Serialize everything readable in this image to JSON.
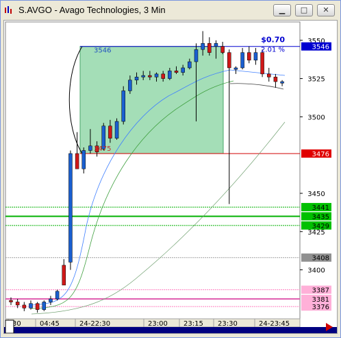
{
  "window": {
    "title": "S.AVGO - Avago Technologies, 3 Min",
    "buttons": [
      {
        "name": "minimize-button",
        "glyph": "▁"
      },
      {
        "name": "maximize-button",
        "glyph": "□"
      },
      {
        "name": "close-button",
        "glyph": "✕"
      }
    ]
  },
  "chart_data": {
    "type": "candlestick",
    "symbol": "S.AVGO",
    "interval": "3 Min",
    "ylim": [
      3368,
      3562
    ],
    "y_ticks": [
      3400,
      3425,
      3450,
      3500,
      3525,
      3550
    ],
    "x_labels": [
      "30",
      "04:45",
      "24-22:30",
      "23:00",
      "23:15",
      "23:30",
      "24-23:45"
    ],
    "price_tags": [
      {
        "value": "3546",
        "price": 3546,
        "bg": "#0000d0",
        "fg": "#ffffff"
      },
      {
        "value": "3476",
        "price": 3476,
        "bg": "#e00000",
        "fg": "#ffffff"
      },
      {
        "value": "3441",
        "price": 3441,
        "bg": "#00c000",
        "fg": "#000000"
      },
      {
        "value": "3435",
        "price": 3435,
        "bg": "#00c000",
        "fg": "#000000"
      },
      {
        "value": "3429",
        "price": 3429,
        "bg": "#00c000",
        "fg": "#000000"
      },
      {
        "value": "3408",
        "price": 3408,
        "bg": "#909090",
        "fg": "#000000"
      },
      {
        "value": "3387",
        "price": 3387,
        "bg": "#ffb0d8",
        "fg": "#000000"
      },
      {
        "value": "3381",
        "price": 3381,
        "bg": "#ffb0d8",
        "fg": "#000000"
      },
      {
        "value": "3376",
        "price": 3376,
        "bg": "#ffb0d8",
        "fg": "#000000"
      }
    ],
    "range_box": {
      "high": 3546,
      "low": 3476,
      "high_label": "3546",
      "low_label": "3475",
      "change_label": "$0.70",
      "change_pct_label": "2.01 %"
    },
    "candles": [
      {
        "o": 3380,
        "h": 3382,
        "l": 3377,
        "c": 3379,
        "up": false
      },
      {
        "o": 3379,
        "h": 3381,
        "l": 3375,
        "c": 3377,
        "up": false
      },
      {
        "o": 3377,
        "h": 3379,
        "l": 3373,
        "c": 3375,
        "up": false
      },
      {
        "o": 3375,
        "h": 3380,
        "l": 3374,
        "c": 3378,
        "up": true
      },
      {
        "o": 3378,
        "h": 3379,
        "l": 3372,
        "c": 3374,
        "up": false
      },
      {
        "o": 3374,
        "h": 3380,
        "l": 3373,
        "c": 3379,
        "up": true
      },
      {
        "o": 3379,
        "h": 3383,
        "l": 3377,
        "c": 3381,
        "up": true
      },
      {
        "o": 3381,
        "h": 3387,
        "l": 3380,
        "c": 3386,
        "up": true
      },
      {
        "o": 3390,
        "h": 3407,
        "l": 3390,
        "c": 3403,
        "up": false
      },
      {
        "o": 3405,
        "h": 3478,
        "l": 3400,
        "c": 3476,
        "up": true
      },
      {
        "o": 3476,
        "h": 3490,
        "l": 3466,
        "c": 3466,
        "up": false
      },
      {
        "o": 3466,
        "h": 3480,
        "l": 3463,
        "c": 3478,
        "up": true
      },
      {
        "o": 3478,
        "h": 3492,
        "l": 3476,
        "c": 3481,
        "up": true
      },
      {
        "o": 3481,
        "h": 3484,
        "l": 3474,
        "c": 3477,
        "up": false
      },
      {
        "o": 3479,
        "h": 3496,
        "l": 3478,
        "c": 3494,
        "up": true
      },
      {
        "o": 3494,
        "h": 3498,
        "l": 3483,
        "c": 3486,
        "up": false
      },
      {
        "o": 3486,
        "h": 3499,
        "l": 3485,
        "c": 3497,
        "up": true
      },
      {
        "o": 3497,
        "h": 3520,
        "l": 3495,
        "c": 3517,
        "up": true
      },
      {
        "o": 3517,
        "h": 3527,
        "l": 3515,
        "c": 3524,
        "up": true
      },
      {
        "o": 3524,
        "h": 3529,
        "l": 3521,
        "c": 3526,
        "up": true
      },
      {
        "o": 3526,
        "h": 3530,
        "l": 3524,
        "c": 3527,
        "up": true
      },
      {
        "o": 3527,
        "h": 3530,
        "l": 3524,
        "c": 3526,
        "up": false
      },
      {
        "o": 3526,
        "h": 3529,
        "l": 3523,
        "c": 3528,
        "up": true
      },
      {
        "o": 3528,
        "h": 3530,
        "l": 3523,
        "c": 3525,
        "up": false
      },
      {
        "o": 3525,
        "h": 3532,
        "l": 3524,
        "c": 3530,
        "up": true
      },
      {
        "o": 3530,
        "h": 3533,
        "l": 3528,
        "c": 3529,
        "up": false
      },
      {
        "o": 3529,
        "h": 3534,
        "l": 3527,
        "c": 3532,
        "up": true
      },
      {
        "o": 3532,
        "h": 3538,
        "l": 3531,
        "c": 3536,
        "up": true
      },
      {
        "o": 3536,
        "h": 3548,
        "l": 3497,
        "c": 3544,
        "up": true
      },
      {
        "o": 3544,
        "h": 3556,
        "l": 3540,
        "c": 3548,
        "up": true
      },
      {
        "o": 3548,
        "h": 3552,
        "l": 3540,
        "c": 3542,
        "up": false
      },
      {
        "o": 3546,
        "h": 3550,
        "l": 3538,
        "c": 3548,
        "up": true
      },
      {
        "o": 3546,
        "h": 3549,
        "l": 3541,
        "c": 3542,
        "up": false
      },
      {
        "o": 3542,
        "h": 3544,
        "l": 3443,
        "c": 3532,
        "up": false
      },
      {
        "o": 3531,
        "h": 3533,
        "l": 3528,
        "c": 3532,
        "up": true
      },
      {
        "o": 3532,
        "h": 3545,
        "l": 3531,
        "c": 3542,
        "up": true
      },
      {
        "o": 3542,
        "h": 3546,
        "l": 3535,
        "c": 3537,
        "up": false
      },
      {
        "o": 3537,
        "h": 3545,
        "l": 3534,
        "c": 3542,
        "up": true
      },
      {
        "o": 3542,
        "h": 3544,
        "l": 3526,
        "c": 3528,
        "up": false
      },
      {
        "o": 3528,
        "h": 3532,
        "l": 3523,
        "c": 3526,
        "up": false
      },
      {
        "o": 3526,
        "h": 3528,
        "l": 3519,
        "c": 3523,
        "up": false
      },
      {
        "o": 3522,
        "h": 3524,
        "l": 3520,
        "c": 3523,
        "up": true
      }
    ]
  }
}
